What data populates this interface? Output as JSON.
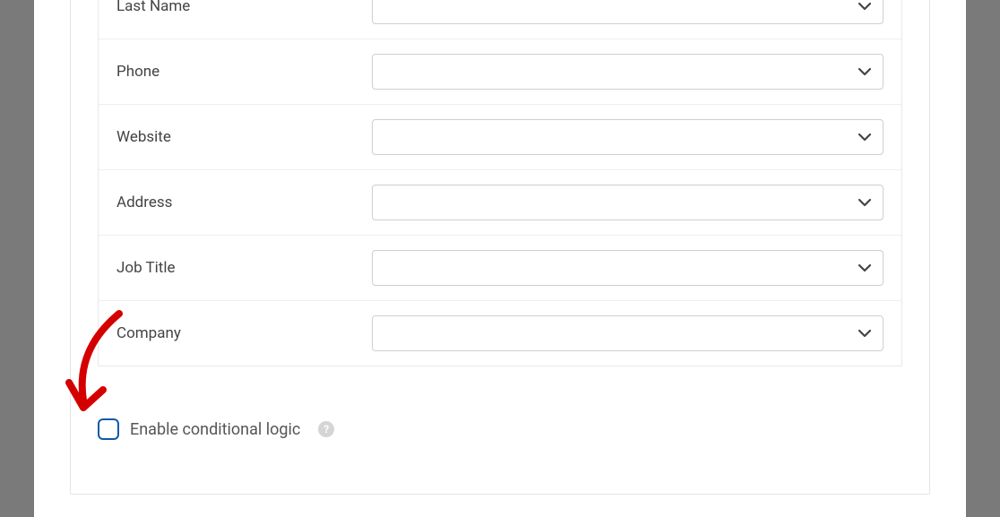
{
  "fields": [
    {
      "label": "Last Name",
      "value": ""
    },
    {
      "label": "Phone",
      "value": ""
    },
    {
      "label": "Website",
      "value": ""
    },
    {
      "label": "Address",
      "value": ""
    },
    {
      "label": "Job Title",
      "value": ""
    },
    {
      "label": "Company",
      "value": ""
    }
  ],
  "checkbox": {
    "label": "Enable conditional logic",
    "help": "?"
  }
}
